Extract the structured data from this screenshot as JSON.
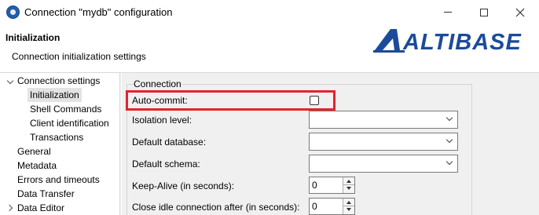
{
  "window": {
    "title": "Connection \"mydb\" configuration",
    "icon": "dbeaver-icon"
  },
  "header": {
    "title": "Initialization",
    "description": "Connection initialization settings",
    "logo_text": "ALTIBASE",
    "logo_color": "#1b4b9a"
  },
  "tree": {
    "items": [
      {
        "label": "Connection settings",
        "expanded": true
      },
      {
        "label": "Initialization",
        "selected": true
      },
      {
        "label": "Shell Commands"
      },
      {
        "label": "Client identification"
      },
      {
        "label": "Transactions"
      },
      {
        "label": "General"
      },
      {
        "label": "Metadata"
      },
      {
        "label": "Errors and timeouts"
      },
      {
        "label": "Data Transfer"
      },
      {
        "label": "Data Editor",
        "expanded": false
      }
    ]
  },
  "connection": {
    "group_label": "Connection",
    "autocommit_label": "Auto-commit:",
    "autocommit_checked": false,
    "highlight_color": "#e3242b",
    "isolation_label": "Isolation level:",
    "isolation_value": "",
    "default_db_label": "Default database:",
    "default_db_value": "",
    "default_schema_label": "Default schema:",
    "default_schema_value": "",
    "keepalive_label": "Keep-Alive (in seconds):",
    "keepalive_value": "0",
    "close_idle_label": "Close idle connection after (in seconds):",
    "close_idle_value": "0"
  }
}
